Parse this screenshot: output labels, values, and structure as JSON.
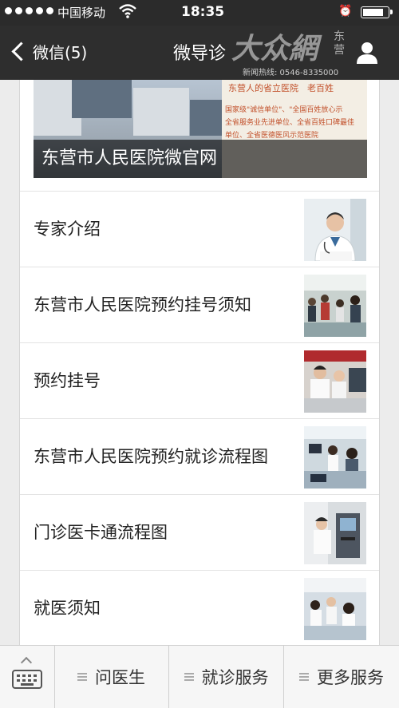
{
  "status_bar": {
    "carrier": "中国移动",
    "time": "18:35",
    "battery_level": 0.85
  },
  "nav": {
    "back_label": "微信(5)",
    "title": "微导诊",
    "watermark": {
      "logo": "大众網",
      "region": "东营",
      "hotline": "新闻热线: 0546-8335000"
    }
  },
  "banner": {
    "caption": "东营市人民医院微官网",
    "poster_lines": [
      "东营人的省立医院　老百姓",
      "国家级\"诚信单位\"、\"全国百姓放心示",
      "全省服务业先进单位、全省百姓口碑最佳",
      "单位、全省医德医风示范医院"
    ]
  },
  "list": [
    {
      "label": "专家介绍",
      "icon": "doctor-photo"
    },
    {
      "label": "东营市人民医院预约挂号须知",
      "icon": "registration-hall-photo"
    },
    {
      "label": "预约挂号",
      "icon": "nurses-desk-photo"
    },
    {
      "label": "东营市人民医院预约就诊流程图",
      "icon": "service-counter-photo"
    },
    {
      "label": "门诊医卡通流程图",
      "icon": "card-machine-photo"
    },
    {
      "label": "就医须知",
      "icon": "nurses-station-photo"
    }
  ],
  "tabbar": {
    "tabs": [
      {
        "label": "问医生"
      },
      {
        "label": "就诊服务"
      },
      {
        "label": "更多服务"
      }
    ]
  }
}
